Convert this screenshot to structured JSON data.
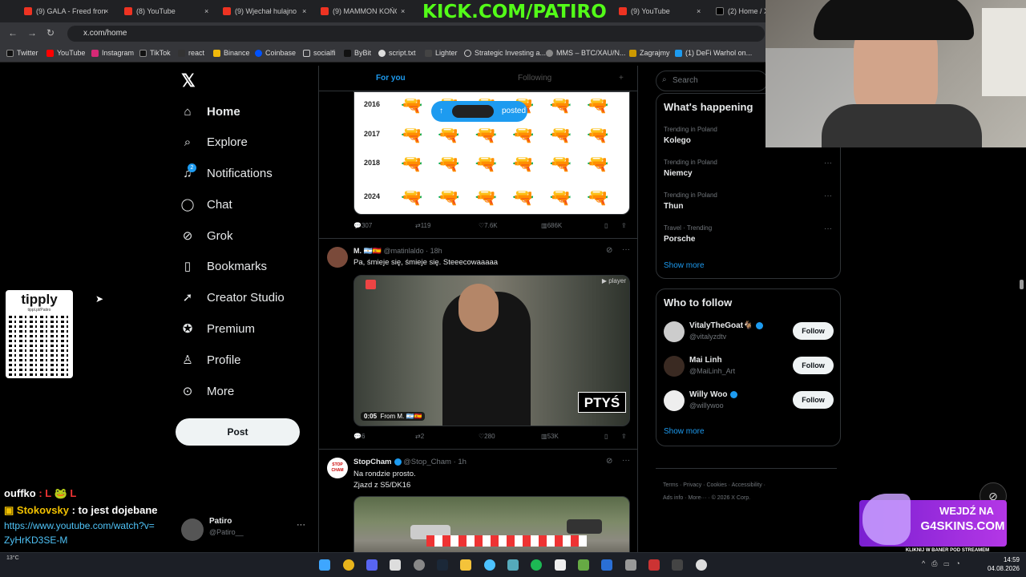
{
  "tabs": [
    {
      "label": "(9) GALA - Freed fron"
    },
    {
      "label": "(8) YouTube"
    },
    {
      "label": "(9) Wjechał hulajnog"
    },
    {
      "label": "(9) MAMMON KOŃC"
    },
    {
      "label": "(9) YouTube"
    },
    {
      "label": "(2) Home / X"
    }
  ],
  "stream_title": "KICK.COM/PATIRO",
  "url": "x.com/home",
  "bookmarks": [
    "Twitter",
    "YouTube",
    "Instagram",
    "TikTok",
    "react",
    "Binance",
    "Coinbase",
    "socialfi",
    "ByBit",
    "script.txt",
    "Lighter",
    "Strategic Investing a...",
    "MMS – BTC/XAU/N...",
    "Zagrajmy",
    "(1) DeFi Warhol on..."
  ],
  "nav": {
    "home": "Home",
    "explore": "Explore",
    "notifications": "Notifications",
    "notif_badge": "2",
    "chat": "Chat",
    "grok": "Grok",
    "bookmarks": "Bookmarks",
    "creator": "Creator Studio",
    "premium": "Premium",
    "profile": "Profile",
    "more": "More",
    "post": "Post"
  },
  "account": {
    "name": "Patiro",
    "handle": "@Patiro__",
    "more": "···"
  },
  "timeline": {
    "tab_foryou": "For you",
    "tab_following": "Following",
    "posted_pill": "posted",
    "tweet1": {
      "years": [
        "2016",
        "2017",
        "2018",
        "2024"
      ],
      "replies": "307",
      "reposts": "119",
      "likes": "7.6K",
      "views": "686K"
    },
    "tweet2": {
      "name": "M. 🇦🇷🇪🇸",
      "handle": "@matinlaldo",
      "time": "· 18h",
      "text": "Pa,  śmieje się, śmieje się. Steeecowaaaaa",
      "video_time": "0:05",
      "video_from": "From",
      "video_from_name": "M. 🇦🇷🇪🇸",
      "overlay_text": "PTYŚ",
      "player_label": "player",
      "replies": "6",
      "reposts": "2",
      "likes": "280",
      "views": "53K"
    },
    "tweet3": {
      "name": "StopCham",
      "handle": "@Stop_Cham",
      "time": "· 1h",
      "line1": "Na rondzie prosto.",
      "line2": "Zjazd z S5/DK16",
      "avatar_text": "STOP CHAM"
    }
  },
  "right": {
    "search_placeholder": "Search",
    "happening_title": "What's happening",
    "trends": [
      {
        "context": "Trending in Poland",
        "name": "Kolego"
      },
      {
        "context": "Trending in Poland",
        "name": "Niemcy"
      },
      {
        "context": "Trending in Poland",
        "name": "Thun"
      },
      {
        "context": "Travel · Trending",
        "name": "Porsche"
      }
    ],
    "show_more": "Show more",
    "wtf_title": "Who to follow",
    "follows": [
      {
        "name": "VitalyTheGoat🐐",
        "handle": "@vitalyzdtv",
        "button": "Follow"
      },
      {
        "name": "Mai Linh",
        "handle": "@MaiLinh_Art",
        "button": "Follow"
      },
      {
        "name": "Willy Woo",
        "handle": "@willywoo",
        "button": "Follow"
      }
    ],
    "footer_line1": "Terms  ·  Privacy  ·  Cookies  ·  Accessibility  ·",
    "footer_line2": "Ads info  ·  More···  ·  © 2026 X Corp."
  },
  "overlay": {
    "tipply": "tipply",
    "tipply_url": "tippl.pl/Patiro",
    "chat": [
      {
        "user": "ouffko",
        "msg": ":  L  🐸  L"
      },
      {
        "user": "Stokovsky",
        "msg": ": to jest dojebane"
      },
      {
        "user": "",
        "msg": "https://www.youtube.com/watch?v=ZyHrKD3SE-M"
      }
    ],
    "banner_line1": "WEJDŹ NA",
    "banner_line2": "G4SKINS.COM",
    "banner_line3": "KLIKNIJ W BANER POD STREAMEM"
  },
  "taskbar": {
    "time": "14:59",
    "date": "04.08.2026",
    "weather": "13°C"
  },
  "colors": {
    "accent": "#1d9bf0",
    "kick": "#53fc18"
  }
}
